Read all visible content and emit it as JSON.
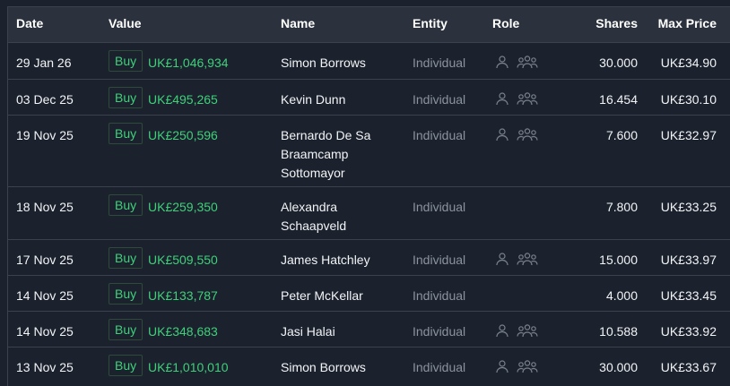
{
  "table": {
    "headers": {
      "date": "Date",
      "value": "Value",
      "name": "Name",
      "entity": "Entity",
      "role": "Role",
      "shares": "Shares",
      "max_price": "Max Price"
    },
    "icons": [
      "person-icon",
      "group-icon"
    ],
    "colors": {
      "buy_green": "#3fd07a",
      "header_bg": "#2b323d",
      "row_bg": "#1b222d",
      "muted_text": "#8b939e"
    },
    "rows": [
      {
        "date": "29 Jan 26",
        "action": "Buy",
        "value": "UK£1,046,934",
        "name": "Simon Borrows",
        "entity": "Individual",
        "role_icons": true,
        "shares": "30.000",
        "max_price": "UK£34.90"
      },
      {
        "date": "03 Dec 25",
        "action": "Buy",
        "value": "UK£495,265",
        "name": "Kevin Dunn",
        "entity": "Individual",
        "role_icons": true,
        "shares": "16.454",
        "max_price": "UK£30.10"
      },
      {
        "date": "19 Nov 25",
        "action": "Buy",
        "value": "UK£250,596",
        "name": "Bernardo De Sa Braamcamp Sottomayor",
        "entity": "Individual",
        "role_icons": true,
        "shares": "7.600",
        "max_price": "UK£32.97"
      },
      {
        "date": "18 Nov 25",
        "action": "Buy",
        "value": "UK£259,350",
        "name": "Alexandra Schaapveld",
        "entity": "Individual",
        "role_icons": false,
        "shares": "7.800",
        "max_price": "UK£33.25"
      },
      {
        "date": "17 Nov 25",
        "action": "Buy",
        "value": "UK£509,550",
        "name": "James Hatchley",
        "entity": "Individual",
        "role_icons": true,
        "shares": "15.000",
        "max_price": "UK£33.97"
      },
      {
        "date": "14 Nov 25",
        "action": "Buy",
        "value": "UK£133,787",
        "name": "Peter McKellar",
        "entity": "Individual",
        "role_icons": false,
        "shares": "4.000",
        "max_price": "UK£33.45"
      },
      {
        "date": "14 Nov 25",
        "action": "Buy",
        "value": "UK£348,683",
        "name": "Jasi Halai",
        "entity": "Individual",
        "role_icons": true,
        "shares": "10.588",
        "max_price": "UK£33.92"
      },
      {
        "date": "13 Nov 25",
        "action": "Buy",
        "value": "UK£1,010,010",
        "name": "Simon Borrows",
        "entity": "Individual",
        "role_icons": true,
        "shares": "30.000",
        "max_price": "UK£33.67"
      }
    ]
  }
}
